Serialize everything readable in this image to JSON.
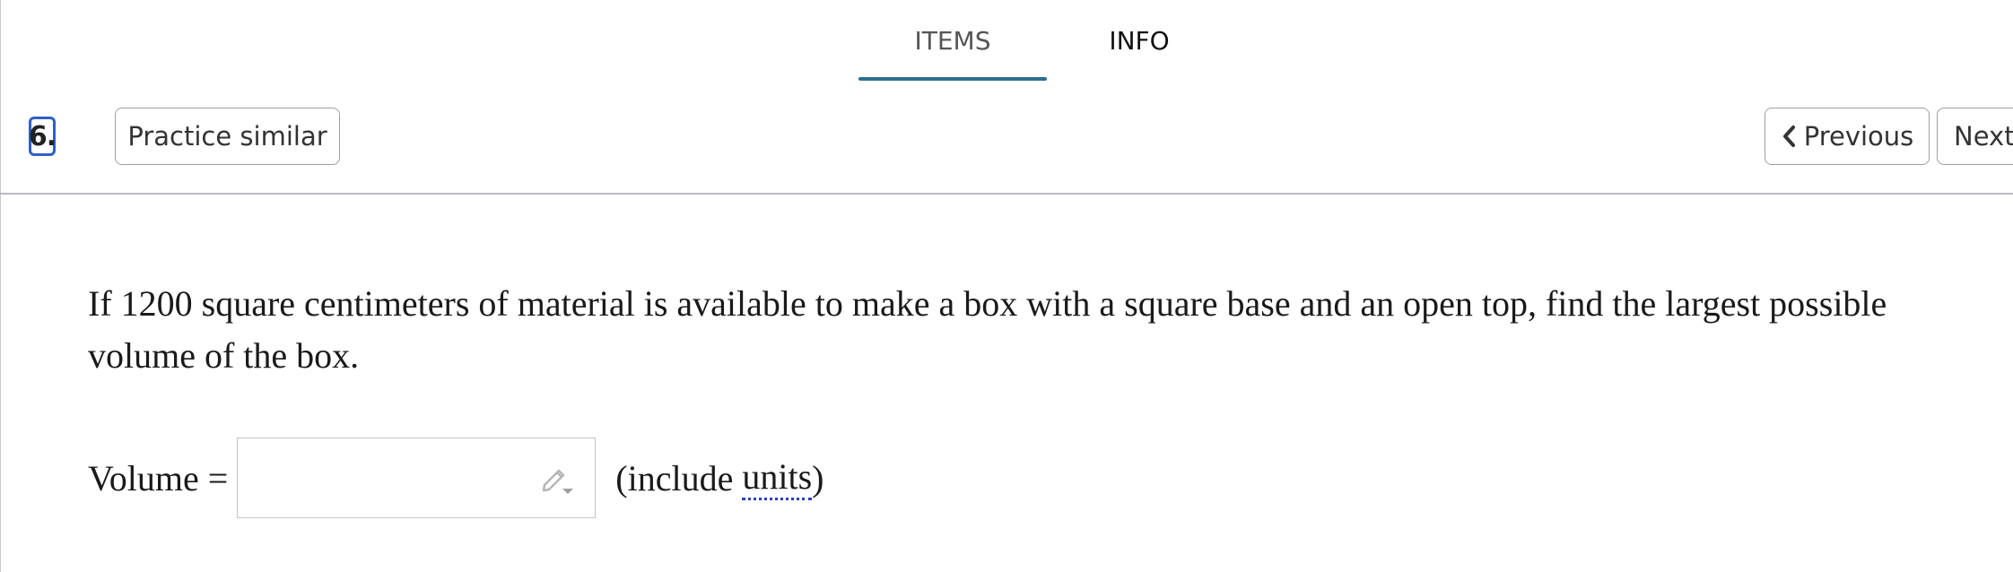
{
  "tabs": {
    "items_label": "ITEMS",
    "info_label": "INFO"
  },
  "toolbar": {
    "question_number": "6.",
    "practice_label": "Practice similar",
    "previous_label": "Previous",
    "next_label": "Next"
  },
  "question": {
    "text": "If 1200 square centimeters of material is available to make a box with a square base and an open top, find the largest possible volume of the box."
  },
  "answer": {
    "label": "Volume =",
    "value": "",
    "paren_open": "(include ",
    "units_link": "units",
    "paren_close": ")"
  },
  "colors": {
    "tab_underline": "#2a6f8e",
    "focus_outline": "#2f5fc4",
    "units_link": "#2a3fbf"
  },
  "icons": {
    "previous": "chevron-left-icon",
    "answer_tool": "pencil-dropdown-icon"
  }
}
